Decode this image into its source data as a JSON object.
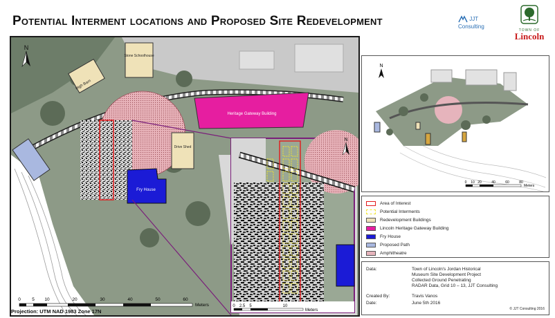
{
  "title": "Potential Interment locations and Proposed Site Redevelopment",
  "logos": {
    "consultant": "JJT Consulting",
    "town_prefix": "TOWN OF",
    "town_name": "Lincoln"
  },
  "map_labels": {
    "north": "N",
    "high_barn": "High Barn",
    "stone_schoolhouse": "Stone Schoolhouse",
    "heritage_gateway": "Heritage Gateway Building",
    "drive_shed": "Drive Shed",
    "fry_house": "Fry House"
  },
  "scale_main": {
    "ticks": [
      "0",
      "5",
      "10",
      "20",
      "30",
      "40",
      "50",
      "60"
    ],
    "unit": "Meters"
  },
  "scale_zoom": {
    "ticks": [
      "0",
      "2.5",
      "5",
      "10"
    ],
    "unit": "Meters"
  },
  "scale_inset": {
    "ticks": [
      "0",
      "10",
      "20",
      "40",
      "60",
      "80"
    ],
    "unit": "Meters"
  },
  "projection": "Projection: UTM NAD 1983 Zone 17N",
  "legend": [
    {
      "label": "Area of Interest",
      "fill": "#ffffff",
      "stroke": "#e31a1c"
    },
    {
      "label": "Potential Interments",
      "fill": "#ffffff",
      "stroke": "#f2e52e"
    },
    {
      "label": "Redevelopment Buildings",
      "fill": "#efe2b8",
      "stroke": "#555555"
    },
    {
      "label": "Lincoln Heritage Gateway Building",
      "fill": "#e61ea0",
      "stroke": "#555555"
    },
    {
      "label": "Fry House",
      "fill": "#1b1bd6",
      "stroke": "#555555"
    },
    {
      "label": "Proposed Path",
      "fill": "#a9b8e0",
      "stroke": "#555555"
    },
    {
      "label": "Amphitheatre",
      "fill": "#e6b4bc",
      "stroke": "#555555"
    }
  ],
  "info": {
    "data_key": "Data:",
    "data_line1": "Town of Lincoln's Jordan Historical",
    "data_line2": "Museum Site Development Project",
    "data_line3": "Collected Ground Penetrating",
    "data_line4": "RADAR Data, Grid 10 – 13, JJT Consulting",
    "created_key": "Created By:",
    "created_val": "Travis Vanos",
    "date_key": "Date:",
    "date_val": "June 5th 2016",
    "copyright": "© JJT Consulting 2016"
  },
  "colors": {
    "grass": "#8d9a87",
    "gateway": "#e61ea0",
    "fry_house": "#1b1bd6",
    "redevelopment": "#efe2b8",
    "amphitheatre": "#e6b4bc",
    "area_of_interest": "#e31a1c",
    "interment": "#f2e52e",
    "zoom_frame": "#7a1e7a"
  }
}
